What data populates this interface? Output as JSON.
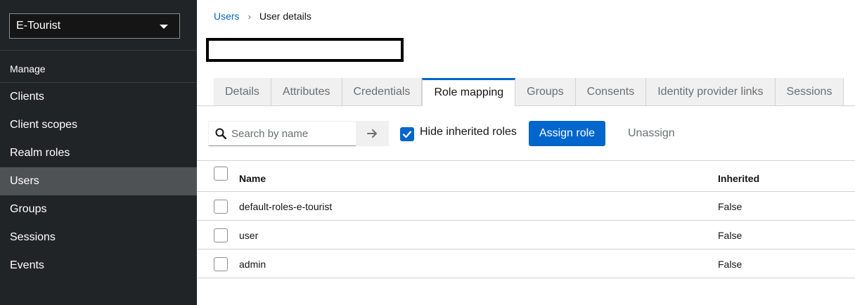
{
  "sidebar": {
    "realm": "E-Tourist",
    "section": "Manage",
    "items": [
      {
        "label": "Clients"
      },
      {
        "label": "Client scopes"
      },
      {
        "label": "Realm roles"
      },
      {
        "label": "Users"
      },
      {
        "label": "Groups"
      },
      {
        "label": "Sessions"
      },
      {
        "label": "Events"
      }
    ],
    "active": "Users"
  },
  "breadcrumb": {
    "parent": "Users",
    "current": "User details"
  },
  "tabs": [
    "Details",
    "Attributes",
    "Credentials",
    "Role mapping",
    "Groups",
    "Consents",
    "Identity provider links",
    "Sessions"
  ],
  "active_tab": "Role mapping",
  "toolbar": {
    "search_placeholder": "Search by name",
    "hide_inherited_label": "Hide inherited roles",
    "hide_inherited_checked": true,
    "assign_label": "Assign role",
    "unassign_label": "Unassign"
  },
  "table": {
    "headers": {
      "name": "Name",
      "inherited": "Inherited"
    },
    "rows": [
      {
        "name": "default-roles-e-tourist",
        "inherited": "False"
      },
      {
        "name": "user",
        "inherited": "False"
      },
      {
        "name": "admin",
        "inherited": "False"
      }
    ]
  },
  "colors": {
    "sidebar_bg": "#212427",
    "active_nav": "#4f5255",
    "accent": "#0066cc"
  }
}
